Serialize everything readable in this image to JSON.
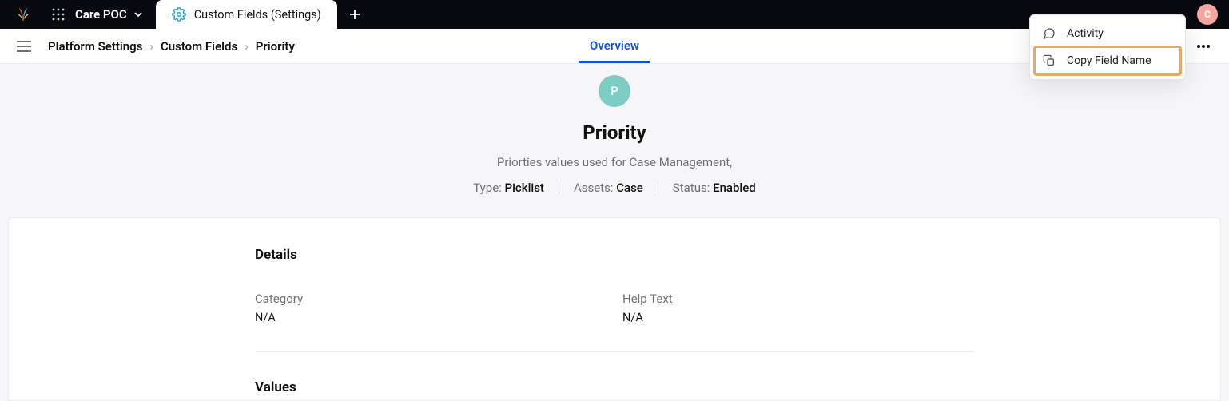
{
  "topbar": {
    "workspace_label": "Care POC",
    "active_tab_label": "Custom Fields (Settings)",
    "avatar_initial": "C"
  },
  "breadcrumbs": {
    "parts": [
      "Platform Settings",
      "Custom Fields",
      "Priority"
    ]
  },
  "tabs": {
    "overview": "Overview"
  },
  "hero": {
    "badge_letter": "P",
    "title": "Priority",
    "description": "Priorties values used for Case Management,",
    "meta": {
      "type_label": "Type:",
      "type_value": "Picklist",
      "assets_label": "Assets:",
      "assets_value": "Case",
      "status_label": "Status:",
      "status_value": "Enabled"
    }
  },
  "details": {
    "heading": "Details",
    "category_label": "Category",
    "category_value": "N/A",
    "help_label": "Help Text",
    "help_value": "N/A",
    "values_heading": "Values"
  },
  "menu": {
    "activity_label": "Activity",
    "copy_label": "Copy Field Name"
  }
}
